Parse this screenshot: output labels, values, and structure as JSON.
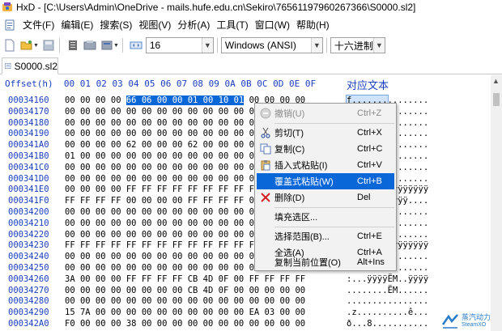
{
  "window": {
    "title": "HxD - [C:\\Users\\Admin\\OneDrive - mails.hufe.edu.cn\\Sekiro\\76561197960267366\\S0000.sl2]"
  },
  "menu": {
    "items": [
      {
        "label": "文件(F)"
      },
      {
        "label": "编辑(E)"
      },
      {
        "label": "搜索(S)"
      },
      {
        "label": "视图(V)"
      },
      {
        "label": "分析(A)"
      },
      {
        "label": "工具(T)"
      },
      {
        "label": "窗口(W)"
      },
      {
        "label": "帮助(H)"
      }
    ]
  },
  "toolbar": {
    "bytes_per_row": "16",
    "charset": "Windows (ANSI)",
    "offset_base": "十六进制"
  },
  "tab": {
    "label": "S0000.sl2"
  },
  "hex": {
    "offset_header": "Offset(h)",
    "column_header": "00 01 02 03 04 05 06 07 08 09 0A 0B 0C 0D 0E 0F",
    "text_header": "对应文本",
    "rows": [
      {
        "offset": "00034160",
        "pre": "00 00 00 00 ",
        "sel": "66 06 00 00 01 00 10 01",
        "post": " 00 00 00 00",
        "ascii": "........",
        "ascii_pre": "",
        "ascii_sel": "f.......",
        "selected": true
      },
      {
        "offset": "00034170",
        "hex": "00 00 00 00 00 00 00 00 00 00 00 00 00 00 00 00",
        "ascii": "................"
      },
      {
        "offset": "00034180",
        "hex": "00 00 00 00 00 00 00 00 00 00 00 00 00 00 00 00",
        "ascii": "................"
      },
      {
        "offset": "00034190",
        "hex": "00 00 00 00 00 00 00 00 00 00 00 00 00 00 00 00",
        "ascii": "................"
      },
      {
        "offset": "000341A0",
        "hex": "00 00 00 00 62 00 00 00 62 00 00 00 00 00 00 00",
        "ascii": "....b...b......."
      },
      {
        "offset": "000341B0",
        "hex": "01 00 00 00 00 00 00 00 00 00 00 00 00 00 00 00",
        "ascii": "................"
      },
      {
        "offset": "000341C0",
        "hex": "00 00 00 00 00 00 00 00 00 00 00 00 00 00 00 00",
        "ascii": "................"
      },
      {
        "offset": "000341D0",
        "hex": "00 00 00 00 00 00 00 00 00 00 00 00 00 00 00 00",
        "ascii": "................"
      },
      {
        "offset": "000341E0",
        "hex": "00 00 00 00 FF FF FF FF FF FF FF FF FF FF FF FF",
        "ascii": "....ÿÿÿÿÿÿÿÿÿÿÿÿ"
      },
      {
        "offset": "000341F0",
        "hex": "FF FF FF FF 00 00 00 00 FF FF FF FF 00 00 00 00",
        "ascii": "ÿÿÿÿ....ÿÿÿÿ...."
      },
      {
        "offset": "00034200",
        "hex": "00 00 00 00 00 00 00 00 00 00 00 00 00 00 00 00",
        "ascii": "................"
      },
      {
        "offset": "00034210",
        "hex": "00 00 00 00 00 00 00 00 00 00 00 00 00 00 00 00",
        "ascii": "................"
      },
      {
        "offset": "00034220",
        "hex": "00 00 00 00 00 00 00 00 00 00 00 00 00 00 00 00",
        "ascii": "................"
      },
      {
        "offset": "00034230",
        "hex": "FF FF FF FF FF FF FF FF FF FF FF FF FF FF FF FF",
        "ascii": "ÿÿÿÿÿÿÿÿÿÿÿÿÿÿÿÿ"
      },
      {
        "offset": "00034240",
        "hex": "00 00 00 00 00 00 00 00 00 00 00 00 00 00 00 00",
        "ascii": "................"
      },
      {
        "offset": "00034250",
        "hex": "00 00 00 00 00 00 00 00 00 00 00 00 01 00 00 00",
        "ascii": "................"
      },
      {
        "offset": "00034260",
        "hex": "3A 00 00 00 FF FF FF FF CB 4D 0F 00 FF FF FF FF",
        "ascii": ":...ÿÿÿÿËM..ÿÿÿÿ"
      },
      {
        "offset": "00034270",
        "hex": "00 00 00 00 00 00 00 00 CB 4D 0F 00 00 00 00 00",
        "ascii": "........ËM......"
      },
      {
        "offset": "00034280",
        "hex": "00 00 00 00 00 00 00 00 00 00 00 00 00 00 00 00",
        "ascii": "................"
      },
      {
        "offset": "00034290",
        "hex": "15 7A 00 00 00 00 00 00 00 00 00 00 EA 03 00 00",
        "ascii": ".z..........ê..."
      },
      {
        "offset": "000342A0",
        "hex": "F0 00 00 00 38 00 00 00 00 00 00 00 00 00 00 00",
        "ascii": "ð...8..........."
      }
    ]
  },
  "context_menu": {
    "items": [
      {
        "label": "撤销(U)",
        "key": "Ctrl+Z",
        "icon": "undo-icon",
        "disabled": true
      },
      {
        "label": "剪切(T)",
        "key": "Ctrl+X",
        "icon": "scissors-icon"
      },
      {
        "label": "复制(C)",
        "key": "Ctrl+C",
        "icon": "copy-icon"
      },
      {
        "label": "插入式粘贴(I)",
        "key": "Ctrl+V",
        "icon": "paste-icon"
      },
      {
        "label": "覆盖式粘贴(W)",
        "key": "Ctrl+B",
        "icon": "",
        "highlighted": true
      },
      {
        "label": "删除(D)",
        "key": "Del",
        "icon": "delete-icon"
      },
      {
        "label": "填充选区...",
        "key": "",
        "icon": ""
      },
      {
        "label": "选择范围(B)...",
        "key": "Ctrl+E",
        "icon": ""
      },
      {
        "label": "全选(A)",
        "key": "Ctrl+A",
        "icon": ""
      },
      {
        "label": "复制当前位置(O)",
        "key": "Alt+Ins",
        "icon": ""
      }
    ]
  },
  "watermark": {
    "line1": "蒸汽动力",
    "line2": "SteamXO"
  },
  "colors": {
    "accent": "#0a67d8",
    "offset_text": "#1a3fbf",
    "delete_red": "#d42020"
  }
}
